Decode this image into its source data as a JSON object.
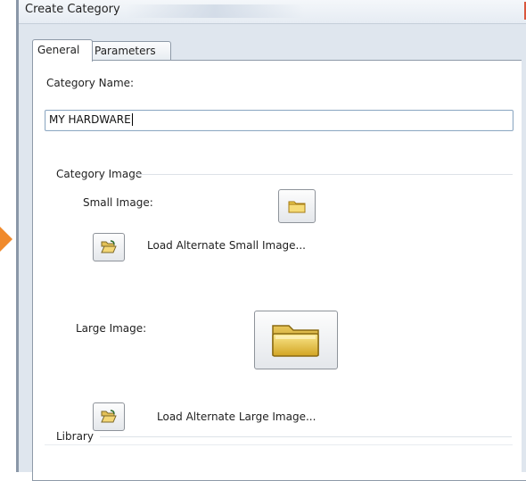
{
  "window": {
    "title": "Create Category"
  },
  "tabs": [
    {
      "label": "General",
      "active": true
    },
    {
      "label": "Parameters",
      "active": false
    }
  ],
  "general": {
    "category_name_label": "Category Name:",
    "category_name_value": "MY HARDWARE",
    "category_image_group": "Category Image",
    "small_image_label": "Small Image:",
    "load_small_label": "Load Alternate Small Image...",
    "large_image_label": "Large Image:",
    "load_large_label": "Load Alternate Large Image...",
    "library_group": "Library"
  },
  "icons": {
    "small_image_preview": "folder-icon",
    "large_image_preview": "folder-icon",
    "load_small": "open-folder-icon",
    "load_large": "open-folder-icon"
  },
  "colors": {
    "accent_arrow": "#f08a2c",
    "folder_gold": "#e8c64a"
  }
}
